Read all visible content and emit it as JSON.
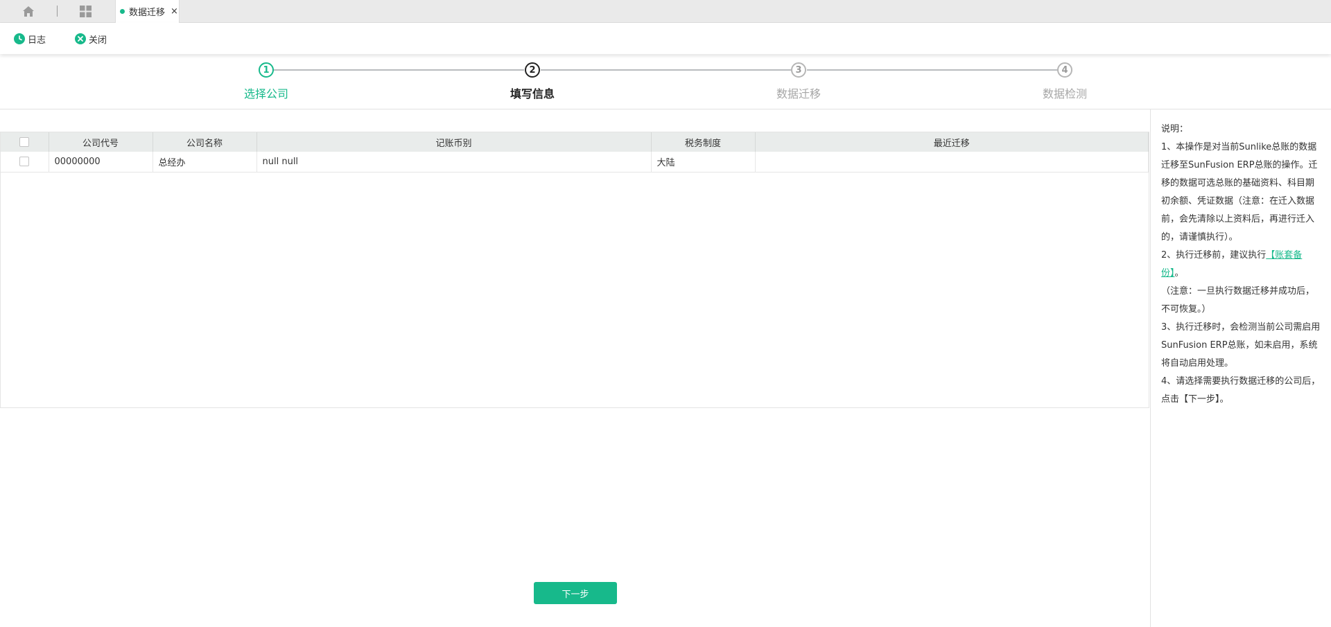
{
  "tabs": {
    "active_tab_label": "数据迁移",
    "close_glyph": "×"
  },
  "toolbar": {
    "log_label": "日志",
    "close_label": "关闭"
  },
  "steps": [
    {
      "num": "1",
      "label": "选择公司",
      "state": "done"
    },
    {
      "num": "2",
      "label": "填写信息",
      "state": "active"
    },
    {
      "num": "3",
      "label": "数据迁移",
      "state": "pending"
    },
    {
      "num": "4",
      "label": "数据检测",
      "state": "pending"
    }
  ],
  "table": {
    "headers": [
      "公司代号",
      "公司名称",
      "记账币别",
      "税务制度",
      "最近迁移"
    ],
    "rows": [
      [
        "00000000",
        "总经办",
        "null null",
        "大陆",
        ""
      ]
    ]
  },
  "next_button_label": "下一步",
  "help": {
    "title": "说明：",
    "p1": "1、本操作是对当前Sunlike总账的数据迁移至SunFusion ERP总账的操作。迁移的数据可选总账的基础资料、科目期初余额、凭证数据（注意：在迁入数据前，会先清除以上资料后，再进行迁入的，请谨慎执行）。",
    "p2_prefix": "2、执行迁移前，建议执行",
    "p2_link": "【账套备份】",
    "p2_suffix": "。",
    "p2_note": "（注意：一旦执行数据迁移并成功后，不可恢复。）",
    "p3": "3、执行迁移时，会检测当前公司需启用SunFusion ERP总账，如未启用，系统将自动启用处理。",
    "p4": "4、请选择需要执行数据迁移的公司后，点击【下一步】。"
  },
  "colors": {
    "accent": "#17b98b",
    "header_bg": "#e9eceb"
  }
}
